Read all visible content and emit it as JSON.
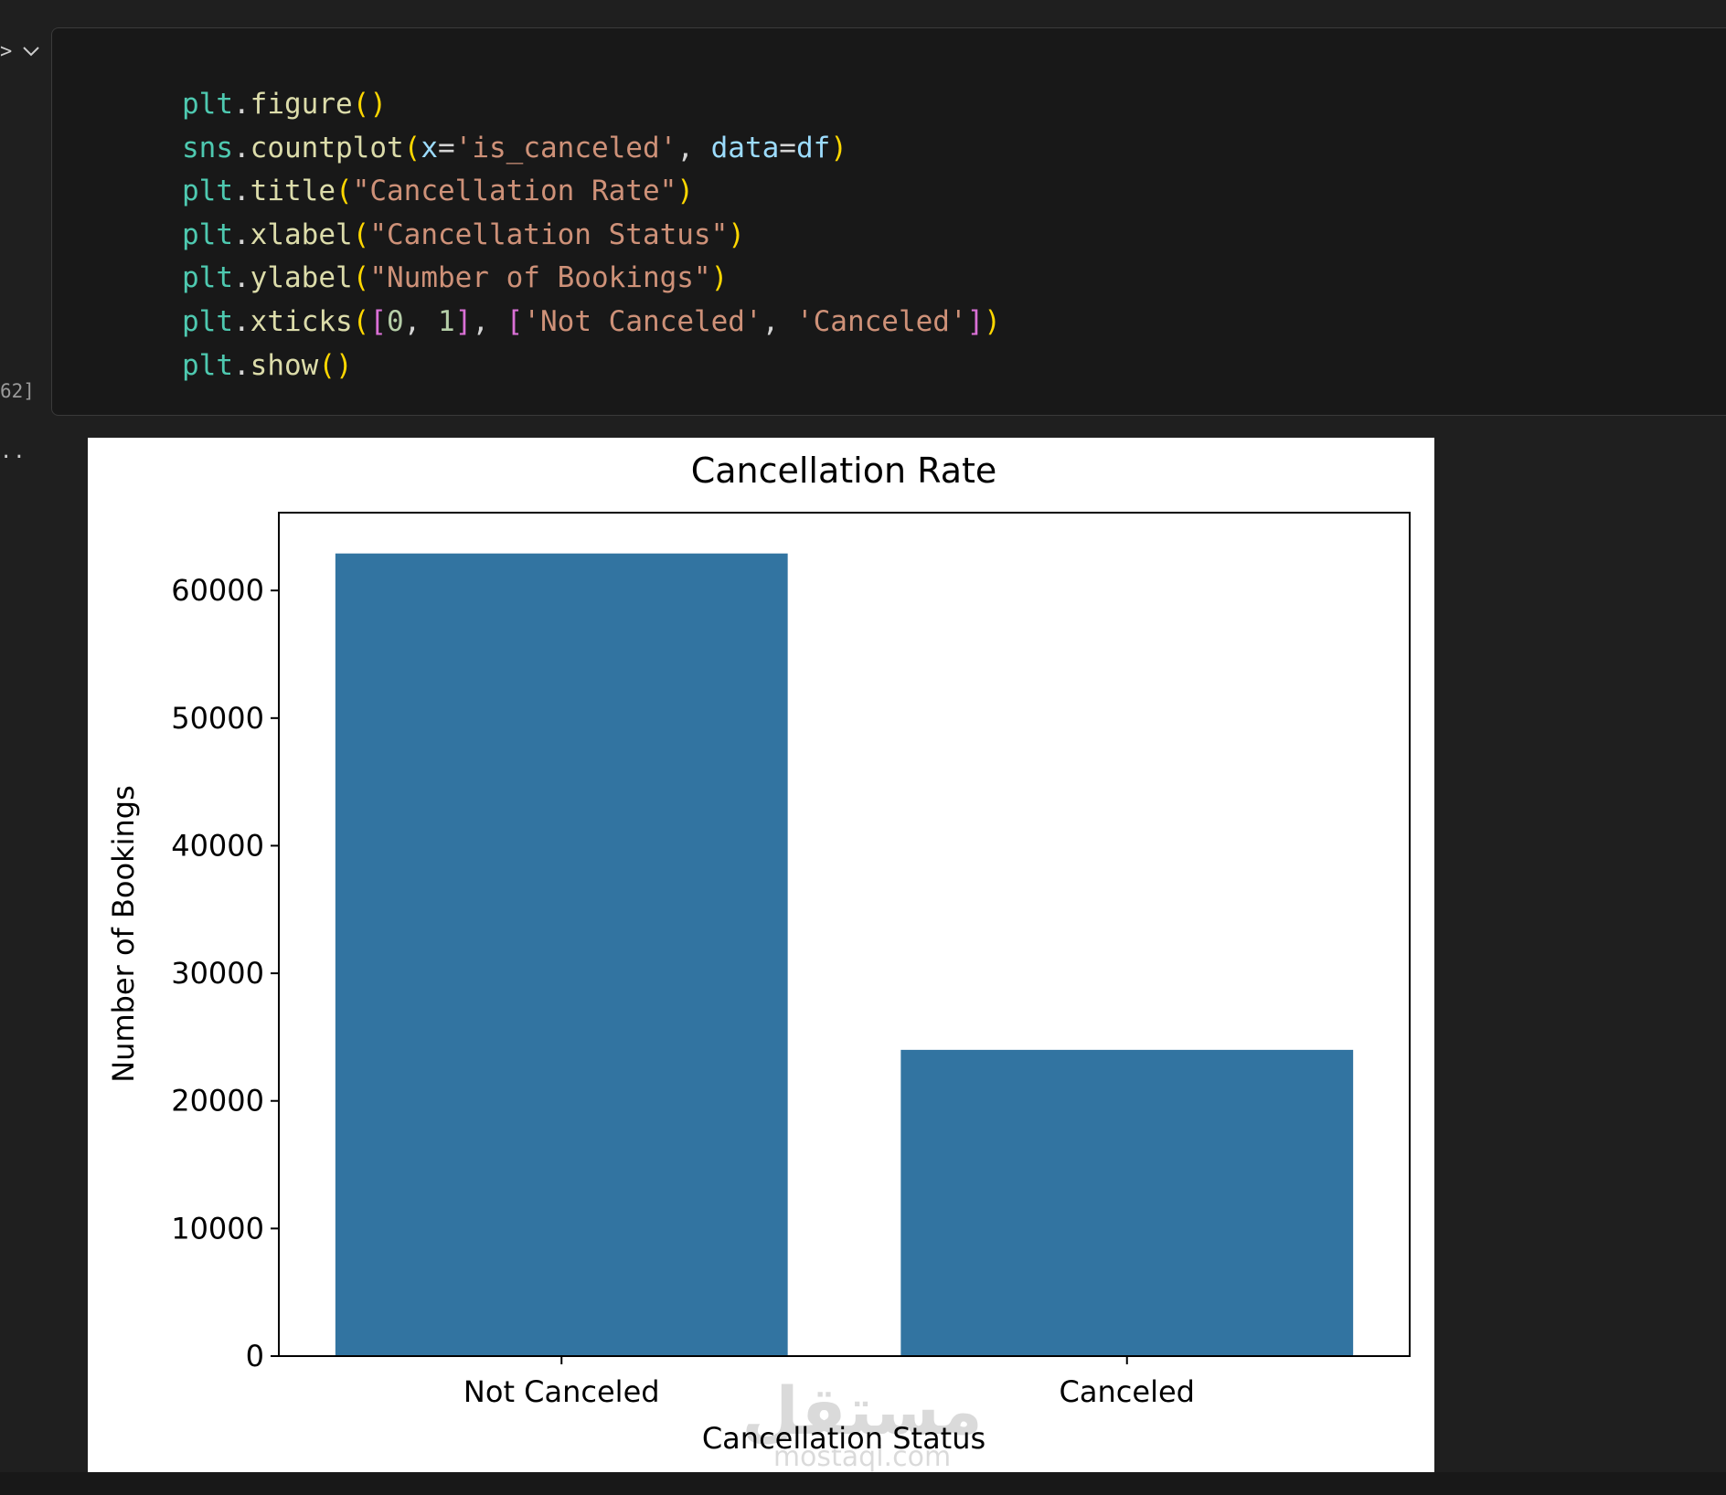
{
  "notebook": {
    "execution_count_fragment": "62]",
    "output_prompt": "..",
    "gutter_icons": [
      "collapse-arrow-icon",
      "chevron-down-icon"
    ],
    "code_lines": [
      [
        [
          "t-mod",
          "plt"
        ],
        [
          "t-op",
          "."
        ],
        [
          "t-fn",
          "figure"
        ],
        [
          "t-par",
          "()"
        ]
      ],
      [
        [
          "t-mod",
          "sns"
        ],
        [
          "t-op",
          "."
        ],
        [
          "t-fn",
          "countplot"
        ],
        [
          "t-par",
          "("
        ],
        [
          "t-arg",
          "x"
        ],
        [
          "t-op",
          "="
        ],
        [
          "t-str",
          "'is_canceled'"
        ],
        [
          "t-op",
          ", "
        ],
        [
          "t-arg",
          "data"
        ],
        [
          "t-op",
          "="
        ],
        [
          "t-arg",
          "df"
        ],
        [
          "t-par",
          ")"
        ]
      ],
      [
        [
          "t-mod",
          "plt"
        ],
        [
          "t-op",
          "."
        ],
        [
          "t-fn",
          "title"
        ],
        [
          "t-par",
          "("
        ],
        [
          "t-str",
          "\"Cancellation Rate\""
        ],
        [
          "t-par",
          ")"
        ]
      ],
      [
        [
          "t-mod",
          "plt"
        ],
        [
          "t-op",
          "."
        ],
        [
          "t-fn",
          "xlabel"
        ],
        [
          "t-par",
          "("
        ],
        [
          "t-str",
          "\"Cancellation Status\""
        ],
        [
          "t-par",
          ")"
        ]
      ],
      [
        [
          "t-mod",
          "plt"
        ],
        [
          "t-op",
          "."
        ],
        [
          "t-fn",
          "ylabel"
        ],
        [
          "t-par",
          "("
        ],
        [
          "t-str",
          "\"Number of Bookings\""
        ],
        [
          "t-par",
          ")"
        ]
      ],
      [
        [
          "t-mod",
          "plt"
        ],
        [
          "t-op",
          "."
        ],
        [
          "t-fn",
          "xticks"
        ],
        [
          "t-par",
          "("
        ],
        [
          "t-br",
          "["
        ],
        [
          "t-num",
          "0"
        ],
        [
          "t-op",
          ", "
        ],
        [
          "t-num",
          "1"
        ],
        [
          "t-br",
          "]"
        ],
        [
          "t-op",
          ", "
        ],
        [
          "t-br",
          "["
        ],
        [
          "t-str",
          "'Not Canceled'"
        ],
        [
          "t-op",
          ", "
        ],
        [
          "t-str",
          "'Canceled'"
        ],
        [
          "t-br",
          "]"
        ],
        [
          "t-par",
          ")"
        ]
      ],
      [
        [
          "t-mod",
          "plt"
        ],
        [
          "t-op",
          "."
        ],
        [
          "t-fn",
          "show"
        ],
        [
          "t-par",
          "()"
        ]
      ]
    ]
  },
  "chart_data": {
    "type": "bar",
    "title": "Cancellation Rate",
    "xlabel": "Cancellation Status",
    "ylabel": "Number of Bookings",
    "categories": [
      "Not Canceled",
      "Canceled"
    ],
    "values": [
      62900,
      24000
    ],
    "ylim": [
      0,
      66100
    ],
    "yticks": [
      0,
      10000,
      20000,
      30000,
      40000,
      50000,
      60000
    ],
    "bar_color": "#3274a1",
    "grid": false,
    "legend": "none"
  },
  "watermark": {
    "arabic": "مستقل",
    "latin": "mostaql.com"
  },
  "colors": {
    "background": "#1f1f1f",
    "cell_background": "#181818",
    "output_background": "#ffffff"
  }
}
